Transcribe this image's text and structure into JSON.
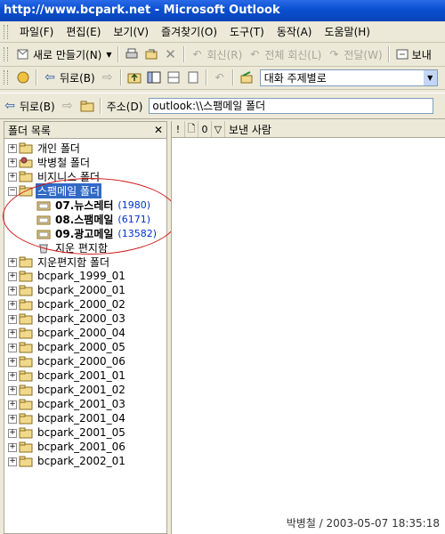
{
  "window": {
    "title": "http://www.bcpark.net - Microsoft Outlook"
  },
  "menu": [
    "파일(F)",
    "편집(E)",
    "보기(V)",
    "즐겨찾기(O)",
    "도구(T)",
    "동작(A)",
    "도움말(H)"
  ],
  "toolbar1": {
    "new_label": "새로 만들기(N)",
    "reply_label": "회신(R)",
    "reply_all_label": "전체 회신(L)",
    "forward_label": "전달(W)",
    "send_label": "보내"
  },
  "toolbar2": {
    "back_label": "뒤로(B)",
    "view_combo_value": "대화 주제별로"
  },
  "addressbar": {
    "back_label": "뒤로(B)",
    "address_label": "주소(D)",
    "address_value": "outlook:\\\\스팸메일 폴더"
  },
  "folder_pane": {
    "header": "폴더 목록",
    "folders": [
      {
        "label": "개인 폴더"
      },
      {
        "label": "박병철 폴더"
      },
      {
        "label": "비지니스 폴더"
      },
      {
        "label": "스팸메일 폴더"
      },
      {
        "label": "07.뉴스레터",
        "count": "(1980)"
      },
      {
        "label": "08.스팸메일",
        "count": "(6171)"
      },
      {
        "label": "09.광고메일",
        "count": "(13582)"
      },
      {
        "label": "지운 편지함"
      },
      {
        "label": "지운편지함 폴더"
      },
      {
        "label": "bcpark_1999_01"
      },
      {
        "label": "bcpark_2000_01"
      },
      {
        "label": "bcpark_2000_02"
      },
      {
        "label": "bcpark_2000_03"
      },
      {
        "label": "bcpark_2000_04"
      },
      {
        "label": "bcpark_2000_05"
      },
      {
        "label": "bcpark_2000_06"
      },
      {
        "label": "bcpark_2001_01"
      },
      {
        "label": "bcpark_2001_02"
      },
      {
        "label": "bcpark_2001_03"
      },
      {
        "label": "bcpark_2001_04"
      },
      {
        "label": "bcpark_2001_05"
      },
      {
        "label": "bcpark_2001_06"
      },
      {
        "label": "bcpark_2002_01"
      }
    ]
  },
  "message_list": {
    "col_sender": "보낸 사람"
  },
  "watermark": "박병철 / 2003-05-07 18:35:18",
  "colors": {
    "selection": "#316ac5",
    "count": "#0033cc",
    "annotation": "#d01818"
  }
}
